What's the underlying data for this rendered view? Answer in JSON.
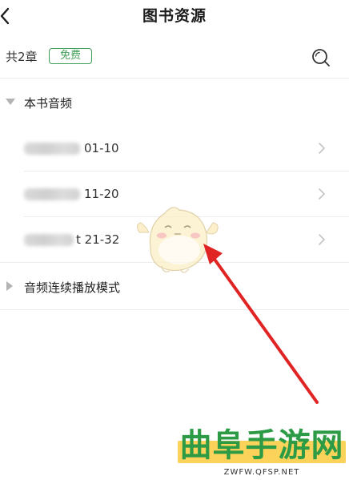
{
  "header": {
    "title": "图书资源"
  },
  "meta": {
    "chapter_count": "共2章",
    "free_badge": "免费"
  },
  "sections": [
    {
      "label": "本书音频",
      "expanded": true
    },
    {
      "label": "音频连续播放模式",
      "expanded": false
    }
  ],
  "items": [
    {
      "range": "01-10"
    },
    {
      "range": "11-20"
    },
    {
      "range": "t 21-32"
    }
  ],
  "watermark": {
    "title": "曲阜手游网",
    "url": "ZWFW.QFSP.NET"
  },
  "colors": {
    "accent_green": "#3f9e57",
    "arrow_red": "#e02424",
    "watermark_yellow": "#fbd35a",
    "watermark_green": "#2d9b45"
  },
  "icons": {
    "back": "chevron-left-icon",
    "search": "search-icon",
    "expand": "triangle-down-icon",
    "collapse": "triangle-right-icon",
    "row": "chevron-right-icon"
  }
}
